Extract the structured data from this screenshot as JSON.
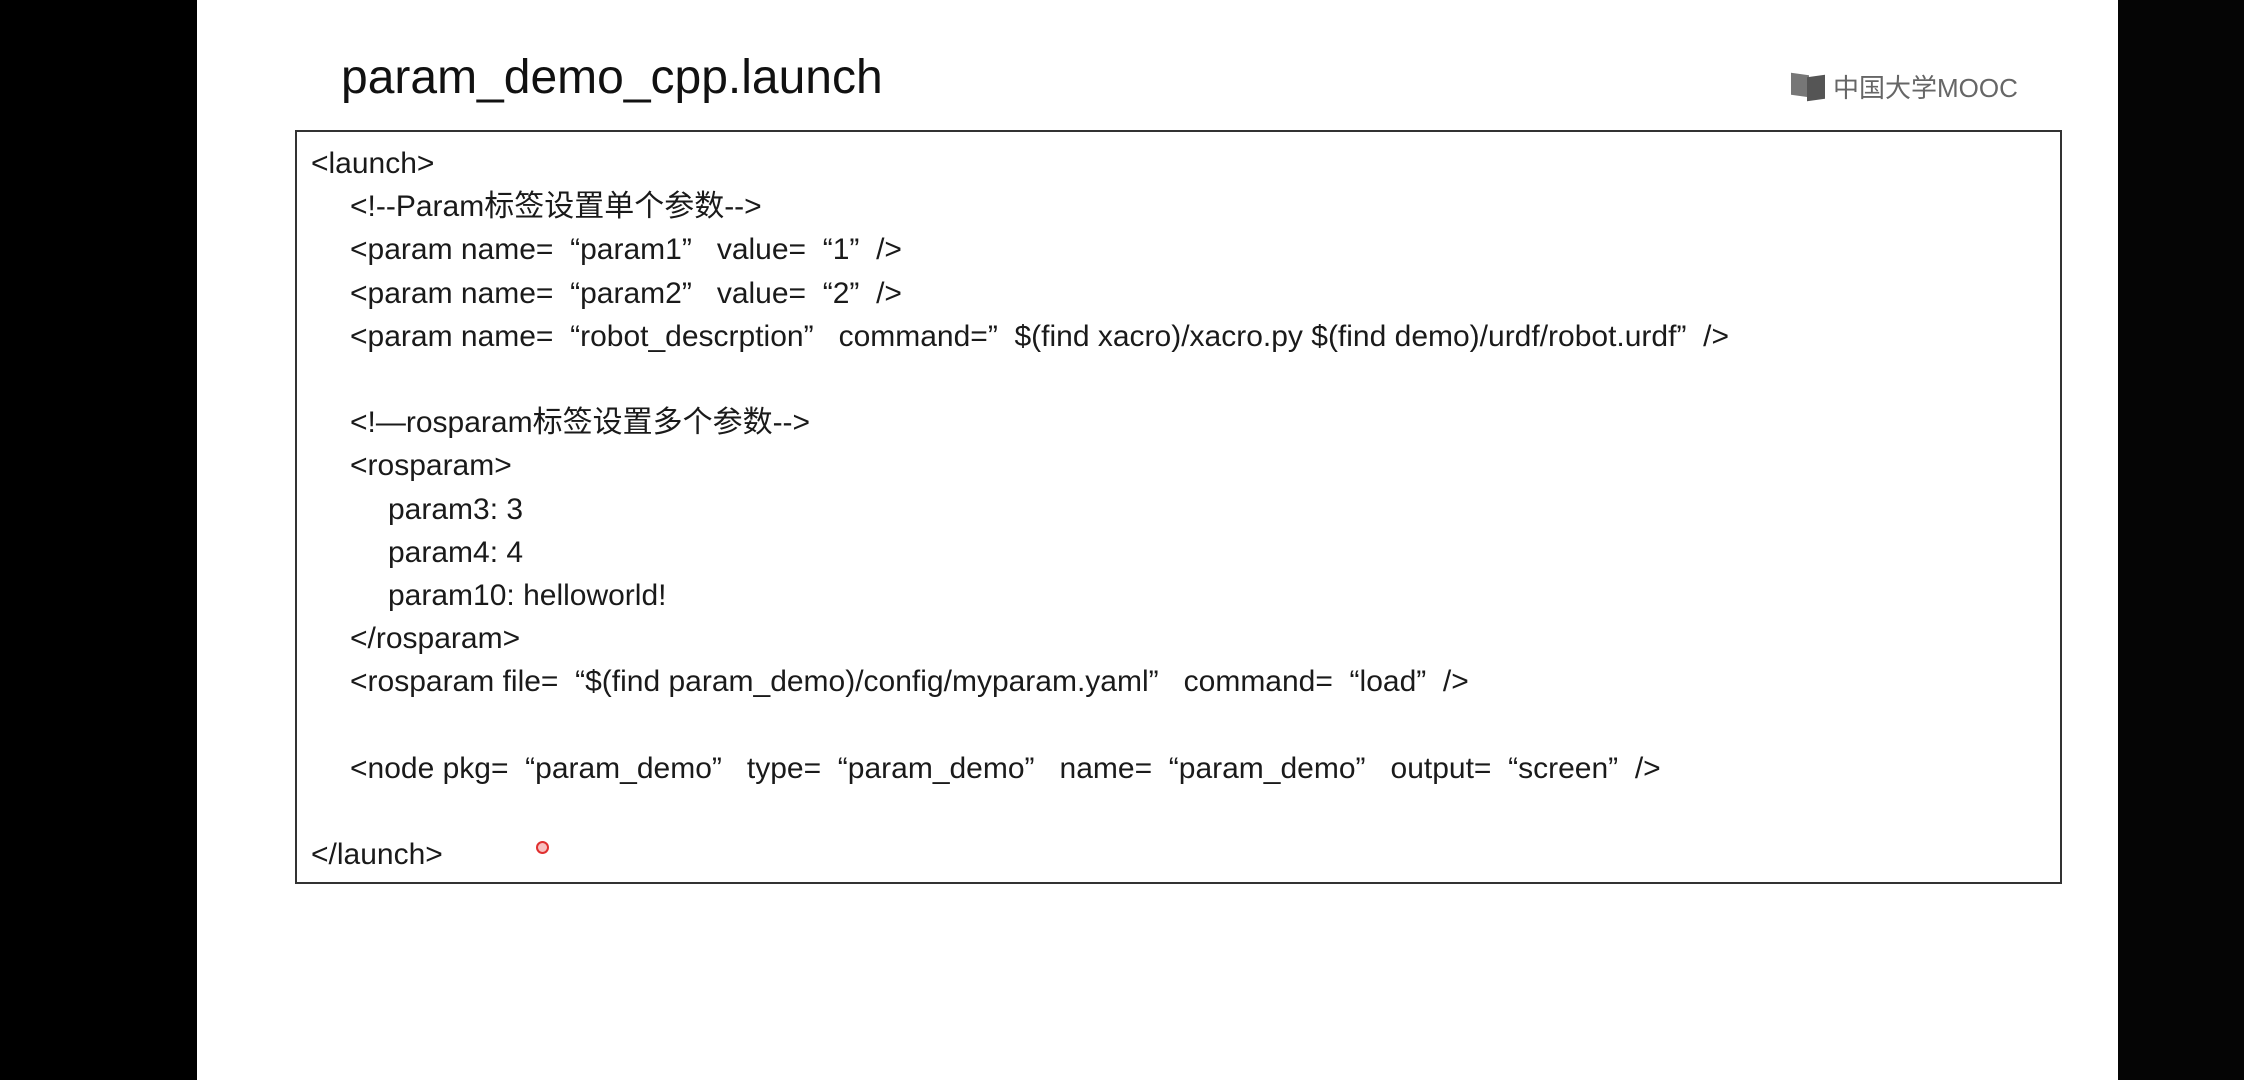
{
  "slide": {
    "title": "param_demo_cpp.launch",
    "logo_text": "中国大学MOOC",
    "code_lines": [
      {
        "indent": 0,
        "text": "<launch>"
      },
      {
        "indent": 1,
        "text": "<!--Param标签设置单个参数-->"
      },
      {
        "indent": 1,
        "text": "<param name=  “param1”   value=  “1”  />"
      },
      {
        "indent": 1,
        "text": "<param name=  “param2”   value=  “2”  />"
      },
      {
        "indent": 1,
        "text": "<param name=  “robot_descrption”   command=”  $(find xacro)/xacro.py $(find demo)/urdf/robot.urdf”  />"
      },
      {
        "indent": 0,
        "text": ""
      },
      {
        "indent": 1,
        "text": "<!—rosparam标签设置多个参数-->"
      },
      {
        "indent": 1,
        "text": "<rosparam>"
      },
      {
        "indent": 2,
        "text": "param3: 3"
      },
      {
        "indent": 2,
        "text": "param4: 4"
      },
      {
        "indent": 2,
        "text": "param10: helloworld!"
      },
      {
        "indent": 1,
        "text": "</rosparam>"
      },
      {
        "indent": 1,
        "text": "<rosparam file=  “$(find param_demo)/config/myparam.yaml”   command=  “load”  />"
      },
      {
        "indent": 0,
        "text": ""
      },
      {
        "indent": 1,
        "text": "<node pkg=  “param_demo”   type=  “param_demo”   name=  “param_demo”   output=  “screen”  />"
      },
      {
        "indent": 0,
        "text": ""
      },
      {
        "indent": 0,
        "text": "</launch>"
      }
    ]
  }
}
